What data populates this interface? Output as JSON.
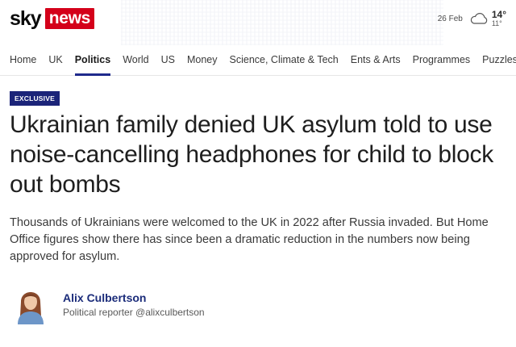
{
  "header": {
    "logo_sky": "sky",
    "logo_news": "news",
    "date": "26 Feb",
    "weather_icon": "cloud-icon",
    "temp_high": "14°",
    "temp_low": "11°"
  },
  "nav": {
    "items": [
      {
        "label": "Home"
      },
      {
        "label": "UK"
      },
      {
        "label": "Politics",
        "active": true
      },
      {
        "label": "World"
      },
      {
        "label": "US"
      },
      {
        "label": "Money"
      },
      {
        "label": "Science, Climate & Tech"
      },
      {
        "label": "Ents & Arts"
      },
      {
        "label": "Programmes"
      },
      {
        "label": "Puzzles"
      }
    ],
    "active_color": "#1f2a8c"
  },
  "article": {
    "badge": "EXCLUSIVE",
    "headline": "Ukrainian family denied UK asylum told to use noise-cancelling headphones for child to block out bombs",
    "standfirst": "Thousands of Ukrainians were welcomed to the UK in 2022 after Russia invaded. But Home Office figures show there has since been a dramatic reduction in the numbers now being approved for asylum.",
    "author": {
      "name": "Alix Culbertson",
      "role": "Political reporter @alixculbertson"
    }
  },
  "colors": {
    "brand_red": "#d4001a",
    "badge_navy": "#1b2479",
    "author_blue": "#1b2c7a"
  }
}
